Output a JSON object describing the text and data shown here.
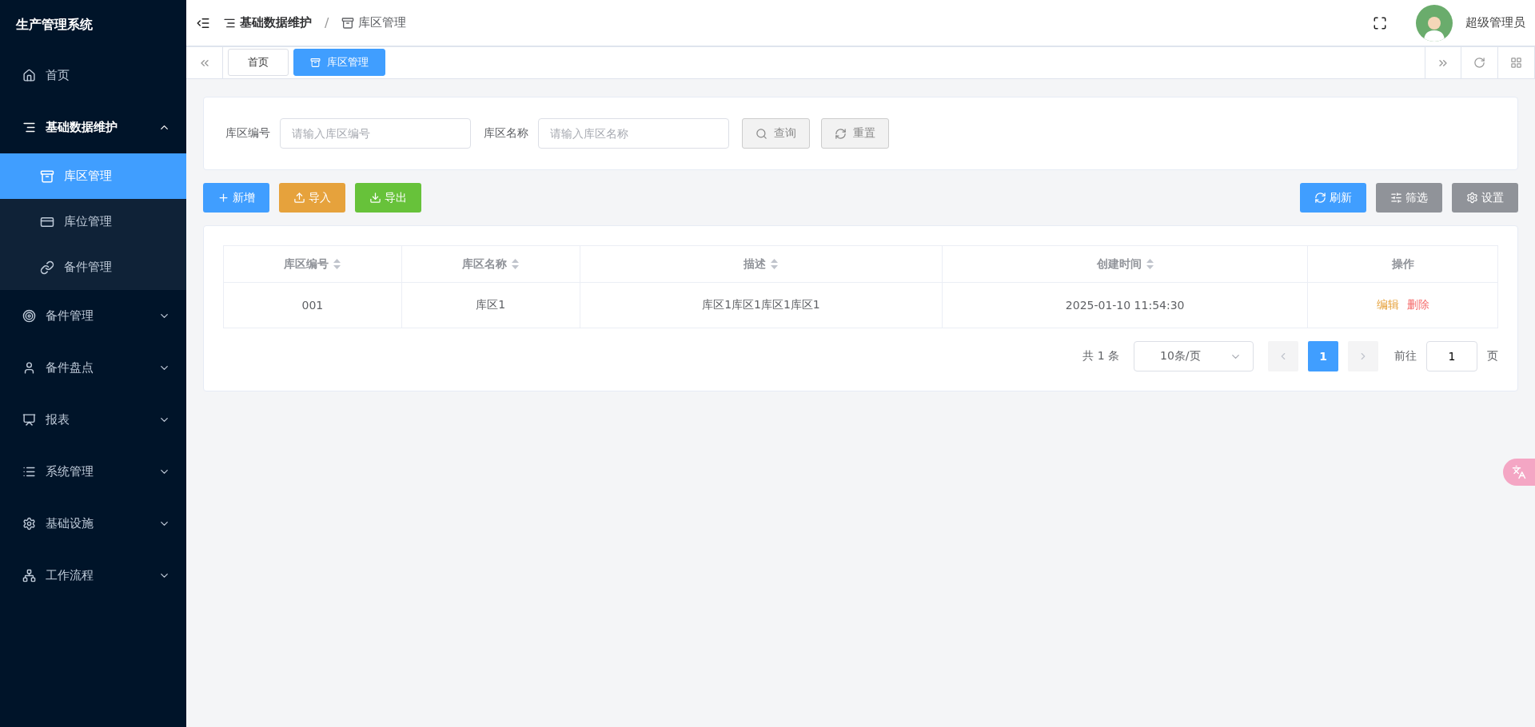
{
  "sidebar": {
    "title": "生产管理系统",
    "items": [
      {
        "label": "首页",
        "expandable": false,
        "expanded": false
      },
      {
        "label": "基础数据维护",
        "expandable": true,
        "expanded": true,
        "children": [
          {
            "label": "库区管理",
            "selected": true
          },
          {
            "label": "库位管理",
            "selected": false
          },
          {
            "label": "备件管理",
            "selected": false
          }
        ]
      },
      {
        "label": "备件管理",
        "expandable": true,
        "expanded": false
      },
      {
        "label": "备件盘点",
        "expandable": true,
        "expanded": false
      },
      {
        "label": "报表",
        "expandable": true,
        "expanded": false
      },
      {
        "label": "系统管理",
        "expandable": true,
        "expanded": false
      },
      {
        "label": "基础设施",
        "expandable": true,
        "expanded": false
      },
      {
        "label": "工作流程",
        "expandable": true,
        "expanded": false
      }
    ]
  },
  "header": {
    "breadcrumb": [
      "基础数据维护",
      "库区管理"
    ],
    "separator": "/",
    "user": "超级管理员"
  },
  "tabs": [
    {
      "label": "首页",
      "selected": false,
      "icon": false
    },
    {
      "label": "库区管理",
      "selected": true,
      "icon": true
    }
  ],
  "search": {
    "fields": [
      {
        "label": "库区编号",
        "placeholder": "请输入库区编号"
      },
      {
        "label": "库区名称",
        "placeholder": "请输入库区名称"
      }
    ],
    "buttons": [
      {
        "label": "查询",
        "kind": "search"
      },
      {
        "label": "重置",
        "kind": "reset"
      }
    ]
  },
  "toolbar": {
    "left": [
      {
        "label": "新增",
        "kind": "add"
      },
      {
        "label": "导入",
        "kind": "import"
      },
      {
        "label": "导出",
        "kind": "export"
      }
    ],
    "right": [
      {
        "label": "刷新",
        "kind": "refresh"
      },
      {
        "label": "筛选",
        "kind": "filter"
      },
      {
        "label": "设置",
        "kind": "settings"
      }
    ]
  },
  "table": {
    "columns": [
      {
        "label": "库区编号",
        "sortable": true
      },
      {
        "label": "库区名称",
        "sortable": true
      },
      {
        "label": "描述",
        "sortable": true
      },
      {
        "label": "创建时间",
        "sortable": true
      },
      {
        "label": "操作",
        "sortable": false
      }
    ],
    "rows": [
      {
        "cells": [
          "001",
          "库区1",
          "库区1库区1库区1库区1",
          "2025-01-10 11:54:30"
        ],
        "actions": [
          {
            "label": "编辑",
            "kind": "edit"
          },
          {
            "label": "删除",
            "kind": "delete"
          }
        ]
      }
    ]
  },
  "pagination": {
    "total": "共 1 条",
    "page_size": "10条/页",
    "pages": [
      {
        "label": "1",
        "selected": true
      }
    ],
    "goto_label": "前往",
    "goto_value": "1",
    "goto_suffix": "页"
  }
}
